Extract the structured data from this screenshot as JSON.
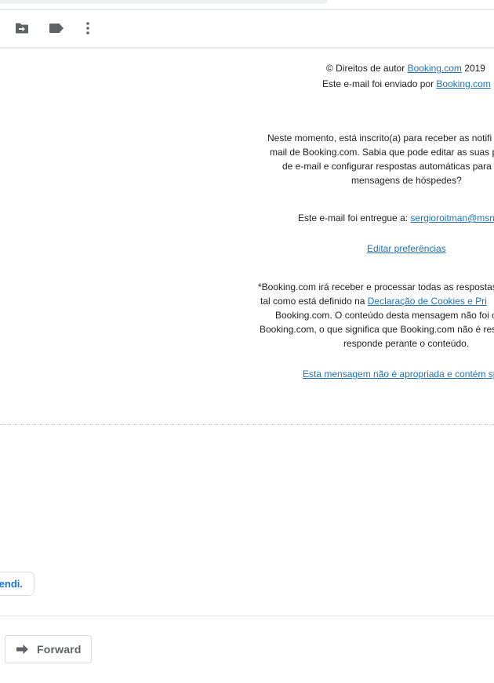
{
  "toolbar": {
    "icons": [
      "move-to-icon",
      "label-icon",
      "more-vertical-icon"
    ]
  },
  "footer": {
    "copyright_prefix": "© Direitos de autor ",
    "copyright_link": "Booking.com",
    "copyright_year": " 2019",
    "sent_by_prefix": "Este e-mail foi enviado por ",
    "sent_by_link": "Booking.com",
    "subscribed_lines": [
      "Neste momento, está inscrito(a) para receber as notifi",
      "mail de Booking.com. Sabia que pode editar as suas p",
      "de e-mail e configurar respostas automáticas para",
      "mensagens de hóspedes?"
    ],
    "delivered_prefix": "Este e-mail foi entregue a: ",
    "delivered_email": "sergioroitman@msn",
    "edit_preferences": "Editar preferências",
    "disclaimer_line1": "*Booking.com irá receber e processar todas as respostas",
    "disclaimer_line2_prefix": "tal como está definido na ",
    "disclaimer_line2_link": "Declaração de Cookies e Pri",
    "disclaimer_line3": "Booking.com. O conteúdo desta mensagem não foi c",
    "disclaimer_line4": "Booking.com, o que significa que Booking.com não é res",
    "disclaimer_line5": "responde perante o conteúdo.",
    "report_link": "Esta mensagem não é apropriada e contém sp"
  },
  "smart_reply": {
    "label": "endi."
  },
  "actions": {
    "forward_label": "Forward"
  }
}
